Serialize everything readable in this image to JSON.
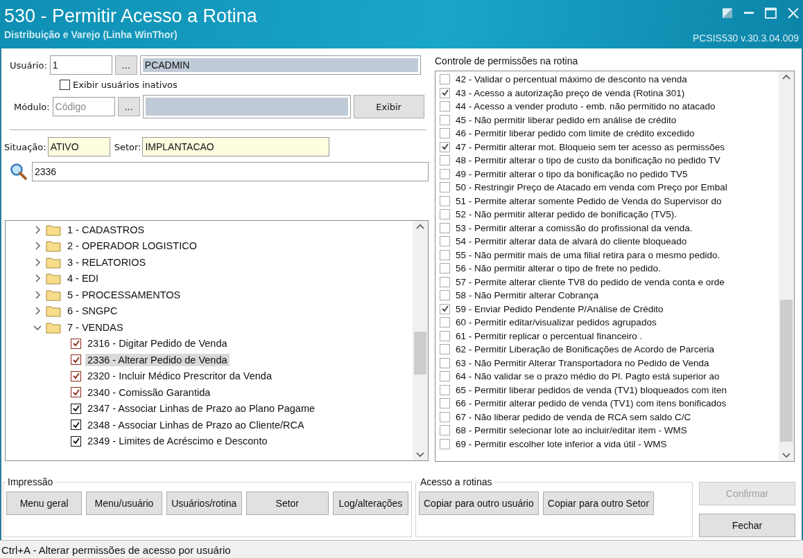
{
  "window": {
    "title": "530 - Permitir Acesso a Rotina",
    "subtitle": "Distribuição e Varejo (Linha WinThor)",
    "version": "PCSIS530  v.30.3.04.009"
  },
  "user": {
    "label": "Usuário:",
    "code": "1",
    "lookup": "...",
    "name": "PCADMIN"
  },
  "show_inactive": {
    "label": "Exibir usuários inativos",
    "checked": false
  },
  "module": {
    "label": "Módulo:",
    "placeholder": "Código",
    "lookup": "...",
    "show_button": "Exibir"
  },
  "situation": {
    "label": "Situação:",
    "value": "ATIVO"
  },
  "sector": {
    "label": "Setor:",
    "value": "IMPLANTACAO"
  },
  "search": {
    "value": "2336"
  },
  "tree": [
    {
      "label": "1 - CADASTROS",
      "expanded": false,
      "selected": false
    },
    {
      "label": "2 - OPERADOR LOGISTICO",
      "expanded": false,
      "selected": false
    },
    {
      "label": "3 - RELATORIOS",
      "expanded": false,
      "selected": false
    },
    {
      "label": "4 - EDI",
      "expanded": false,
      "selected": false
    },
    {
      "label": "5 - PROCESSAMENTOS",
      "expanded": false,
      "selected": false
    },
    {
      "label": "6 - SNGPC",
      "expanded": false,
      "selected": false
    },
    {
      "label": "7 - VENDAS",
      "expanded": true,
      "selected": false,
      "children": [
        {
          "label": "2316 - Digitar Pedido de Venda",
          "checked": true,
          "color": "#8a2a1a",
          "selected": false
        },
        {
          "label": "2336 - Alterar Pedido de Venda",
          "checked": true,
          "color": "#8a2a1a",
          "selected": true
        },
        {
          "label": "2320 - Incluir Médico Prescritor da Venda",
          "checked": true,
          "color": "#8a2a1a",
          "selected": false
        },
        {
          "label": "2340 - Comissão Garantida",
          "checked": true,
          "color": "#8a2a1a",
          "selected": false
        },
        {
          "label": "2347 - Associar Linhas de Prazo ao Plano Pagame",
          "checked": true,
          "color": "#111111",
          "selected": false
        },
        {
          "label": "2348 - Associar Linhas de Prazo ao Cliente/RCA",
          "checked": true,
          "color": "#111111",
          "selected": false
        },
        {
          "label": "2349 - Limites de Acréscimo e Desconto",
          "checked": true,
          "color": "#111111",
          "selected": false
        }
      ]
    }
  ],
  "permissions": {
    "title": "Controle de permissões na rotina",
    "items": [
      {
        "label": "42 - Validar o percentual máximo de desconto na venda",
        "checked": false
      },
      {
        "label": "43 - Acesso a autorização preço de venda (Rotina 301)",
        "checked": true
      },
      {
        "label": "44 - Acesso a vender produto - emb. não permitido no atacado",
        "checked": false
      },
      {
        "label": "45 - Não permitir liberar pedido em análise de crédito",
        "checked": false
      },
      {
        "label": "46 - Permitir liberar pedido com limite de crédito excedido",
        "checked": false
      },
      {
        "label": "47 - Permitir alterar mot. Bloqueio sem ter acesso as permissões",
        "checked": true
      },
      {
        "label": "48 - Permitir alterar o tipo de custo da bonificação no pedido TV",
        "checked": false
      },
      {
        "label": "49 - Permitir alterar o tipo da bonificação no pedido TV5",
        "checked": false
      },
      {
        "label": "50 - Restringir Preço de Atacado em venda com Preço por Embal",
        "checked": false
      },
      {
        "label": "51 - Permite alterar somente Pedido de Venda do Supervisor do",
        "checked": false
      },
      {
        "label": "52 - Não permitir alterar pedido de bonificação (TV5).",
        "checked": false
      },
      {
        "label": "53 - Permitir alterar a comissão do profissional da venda.",
        "checked": false
      },
      {
        "label": "54 - Permitir alterar data de alvará do cliente bloqueado",
        "checked": false
      },
      {
        "label": "55 - Não permitir mais de uma filial retira para o mesmo pedido.",
        "checked": false
      },
      {
        "label": "56 - Não permitir alterar o tipo de frete no pedido.",
        "checked": false
      },
      {
        "label": "57 - Permite alterar cliente TV8 do pedido de venda conta e orde",
        "checked": false
      },
      {
        "label": "58 - Não Permitir alterar Cobrança",
        "checked": false
      },
      {
        "label": "59 - Enviar Pedido Pendente P/Análise de Crédito",
        "checked": true
      },
      {
        "label": "60 - Permitir editar/visualizar pedidos agrupados",
        "checked": false
      },
      {
        "label": "61 - Permitir replicar o percentual financeiro .",
        "checked": false
      },
      {
        "label": "62 - Permitir Liberação de Bonificações de Acordo de Parceria",
        "checked": false
      },
      {
        "label": "63 - Não Permitir Alterar Transportadora no Pedido de Venda",
        "checked": false
      },
      {
        "label": "64 - Não validar se o prazo médio do Pl. Pagto está superior ao",
        "checked": false
      },
      {
        "label": "65 - Permitir liberar pedidos de venda (TV1) bloqueados com iten",
        "checked": false
      },
      {
        "label": "66 - Permitir alterar pedido de venda (TV1) com itens bonificados",
        "checked": false
      },
      {
        "label": "67 - Não liberar pedido de venda de RCA sem saldo C/C",
        "checked": false
      },
      {
        "label": "68 - Permitir selecionar lote ao incluir/editar item - WMS",
        "checked": false
      },
      {
        "label": "69 - Permitir escolher lote inferior a vida útil - WMS",
        "checked": false
      }
    ]
  },
  "print_group": {
    "title": "Impressão",
    "buttons": [
      "Menu geral",
      "Menu/usuário",
      "Usuários/rotina",
      "Setor",
      "Log/alterações"
    ]
  },
  "access_group": {
    "title": "Acesso a rotinas",
    "buttons": [
      "Copiar para outro usuário",
      "Copiar para outro Setor"
    ]
  },
  "actions": [
    {
      "label": "Confirmar",
      "disabled": true
    },
    {
      "label": "Fechar",
      "disabled": false
    }
  ],
  "status_bar": "Ctrl+A - Alterar permissões de acesso por usuário"
}
